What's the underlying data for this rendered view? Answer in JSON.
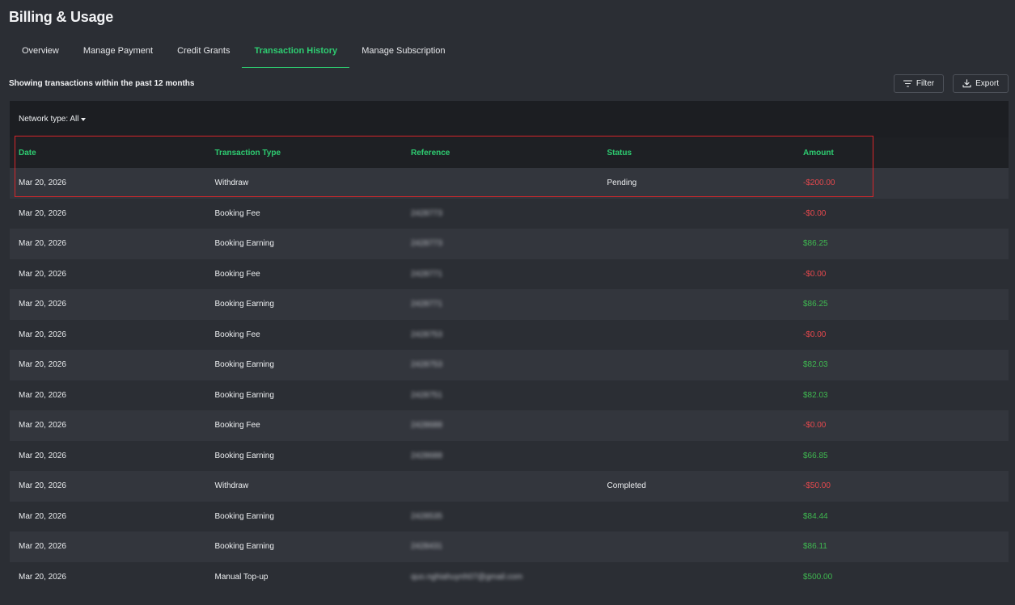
{
  "page": {
    "title": "Billing & Usage"
  },
  "tabs": [
    {
      "label": "Overview"
    },
    {
      "label": "Manage Payment"
    },
    {
      "label": "Credit Grants"
    },
    {
      "label": "Transaction History"
    },
    {
      "label": "Manage Subscription"
    }
  ],
  "active_tab": "Transaction History",
  "subtitle": "Showing transactions within the past 12 months",
  "actions": {
    "filter_label": "Filter",
    "export_label": "Export"
  },
  "filter": {
    "network_type_label": "Network type: All"
  },
  "table": {
    "columns": [
      "Date",
      "Transaction Type",
      "Reference",
      "Status",
      "Amount"
    ],
    "rows": [
      {
        "date": "Mar 20, 2026",
        "type": "Withdraw",
        "reference": "",
        "status": "Pending",
        "amount": "-$200.00",
        "sign": "neg"
      },
      {
        "date": "Mar 20, 2026",
        "type": "Booking Fee",
        "reference": "2428773",
        "status": "",
        "amount": "-$0.00",
        "sign": "neg"
      },
      {
        "date": "Mar 20, 2026",
        "type": "Booking Earning",
        "reference": "2428773",
        "status": "",
        "amount": "$86.25",
        "sign": "pos"
      },
      {
        "date": "Mar 20, 2026",
        "type": "Booking Fee",
        "reference": "2428771",
        "status": "",
        "amount": "-$0.00",
        "sign": "neg"
      },
      {
        "date": "Mar 20, 2026",
        "type": "Booking Earning",
        "reference": "2428771",
        "status": "",
        "amount": "$86.25",
        "sign": "pos"
      },
      {
        "date": "Mar 20, 2026",
        "type": "Booking Fee",
        "reference": "2428753",
        "status": "",
        "amount": "-$0.00",
        "sign": "neg"
      },
      {
        "date": "Mar 20, 2026",
        "type": "Booking Earning",
        "reference": "2428753",
        "status": "",
        "amount": "$82.03",
        "sign": "pos"
      },
      {
        "date": "Mar 20, 2026",
        "type": "Booking Earning",
        "reference": "2428751",
        "status": "",
        "amount": "$82.03",
        "sign": "pos"
      },
      {
        "date": "Mar 20, 2026",
        "type": "Booking Fee",
        "reference": "2428688",
        "status": "",
        "amount": "-$0.00",
        "sign": "neg"
      },
      {
        "date": "Mar 20, 2026",
        "type": "Booking Earning",
        "reference": "2428688",
        "status": "",
        "amount": "$66.85",
        "sign": "pos"
      },
      {
        "date": "Mar 20, 2026",
        "type": "Withdraw",
        "reference": "",
        "status": "Completed",
        "amount": "-$50.00",
        "sign": "neg"
      },
      {
        "date": "Mar 20, 2026",
        "type": "Booking Earning",
        "reference": "2428535",
        "status": "",
        "amount": "$84.44",
        "sign": "pos"
      },
      {
        "date": "Mar 20, 2026",
        "type": "Booking Earning",
        "reference": "2428431",
        "status": "",
        "amount": "$86.11",
        "sign": "pos"
      },
      {
        "date": "Mar 20, 2026",
        "type": "Manual Top-up",
        "reference": "quo.nghiahuynh07@gmail.com",
        "status": "",
        "amount": "$500.00",
        "sign": "pos"
      }
    ]
  },
  "colors": {
    "accent": "#2ecc71",
    "negative": "#e5484d",
    "positive": "#3fb950",
    "highlight": "#d6262b"
  },
  "icons": {
    "filter": "filter-icon",
    "export": "download-icon",
    "dropdown": "caret-down-icon"
  }
}
